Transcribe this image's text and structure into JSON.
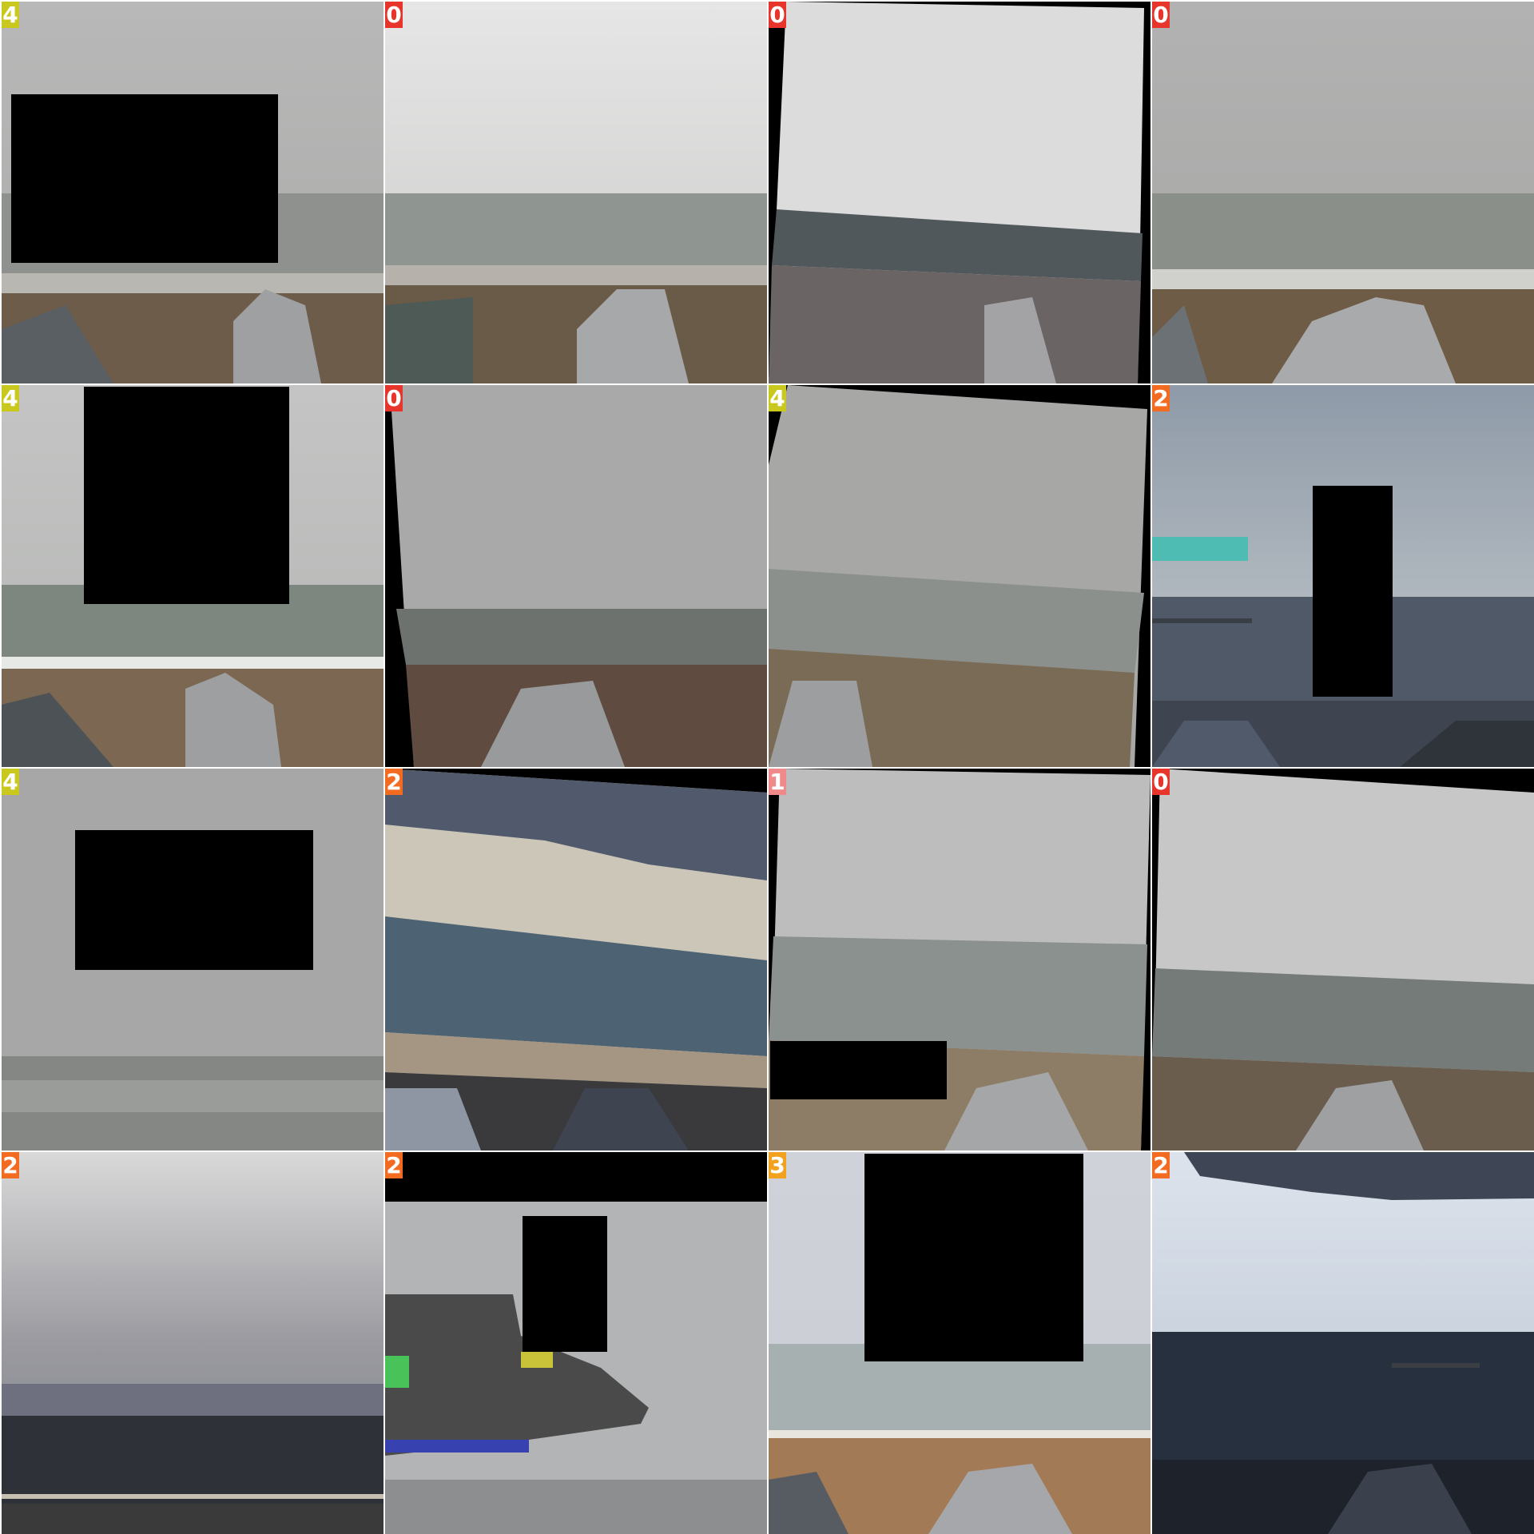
{
  "grid": {
    "tiles": [
      {
        "label": "4",
        "badge_color": "#c8c81e",
        "scene": "stormy-beach"
      },
      {
        "label": "0",
        "badge_color": "#e8352b",
        "scene": "foggy-beach"
      },
      {
        "label": "0",
        "badge_color": "#e8352b",
        "scene": "blurred-rotated-beach"
      },
      {
        "label": "0",
        "badge_color": "#e8352b",
        "scene": "stormy-beach"
      },
      {
        "label": "4",
        "badge_color": "#c8c81e",
        "scene": "stormy-surf-beach"
      },
      {
        "label": "0",
        "badge_color": "#e8352b",
        "scene": "dark-foggy-beach"
      },
      {
        "label": "4",
        "badge_color": "#c8c81e",
        "scene": "rotated-stormy-beach"
      },
      {
        "label": "2",
        "badge_color": "#f26b21",
        "scene": "clear-dusk-beach"
      },
      {
        "label": "4",
        "badge_color": "#c8c81e",
        "scene": "dense-fog-sea"
      },
      {
        "label": "2",
        "badge_color": "#f26b21",
        "scene": "storm-clouds-beach"
      },
      {
        "label": "1",
        "badge_color": "#f08a8a",
        "scene": "rotated-stormy-beach"
      },
      {
        "label": "0",
        "badge_color": "#e8352b",
        "scene": "rotated-blurred-beach"
      },
      {
        "label": "2",
        "badge_color": "#f26b21",
        "scene": "overcast-sea"
      },
      {
        "label": "2",
        "badge_color": "#f26b21",
        "scene": "color-artifact-sea"
      },
      {
        "label": "3",
        "badge_color": "#f2a21e",
        "scene": "cloudy-beach"
      },
      {
        "label": "2",
        "badge_color": "#f26b21",
        "scene": "dark-cloud-sea"
      }
    ]
  }
}
